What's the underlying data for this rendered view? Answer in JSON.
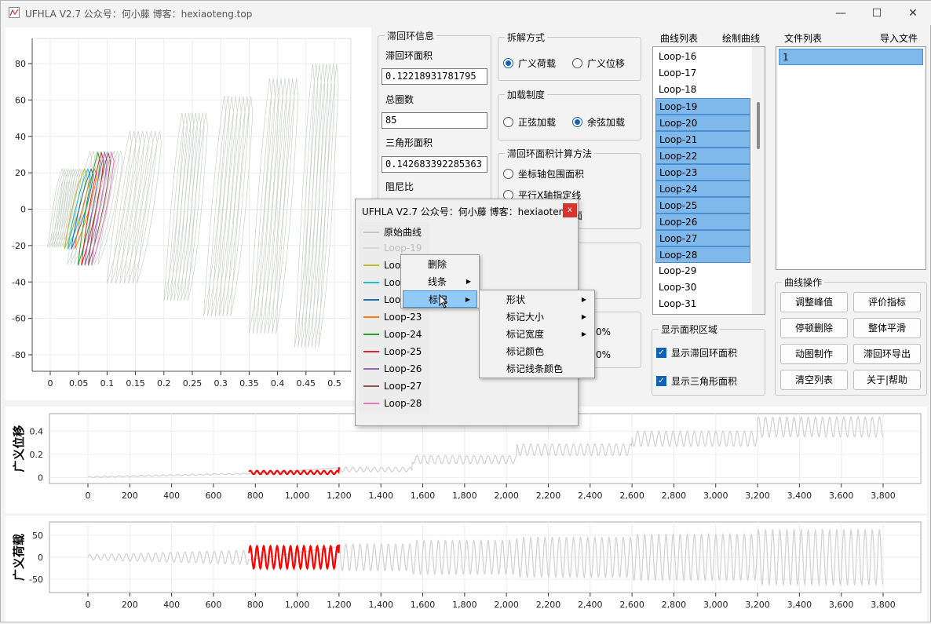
{
  "window": {
    "title": "UFHLA V2.7 公众号：何小藤 博客：hexiaoteng.top",
    "minimize": "—",
    "maximize": "☐",
    "close": "✕"
  },
  "main_plot": {
    "x_ticks": [
      "0",
      "0.05",
      "0.1",
      "0.15",
      "0.2",
      "0.25",
      "0.3",
      "0.35",
      "0.4",
      "0.45",
      "0.5"
    ],
    "y_ticks": [
      "80",
      "60",
      "40",
      "20",
      "0",
      "-20",
      "-40",
      "-60",
      "-80"
    ]
  },
  "hysteresis_info": {
    "title": "滞回环信息",
    "area_label": "滞回环面积",
    "area_value": "0.12218931781795",
    "loops_label": "总圈数",
    "loops_value": "85",
    "triangle_label": "三角形面积",
    "triangle_value": "0.142683392285363",
    "damping_label": "阻尼比"
  },
  "decompose": {
    "title": "拆解方式",
    "opt1": "广义荷载",
    "opt2": "广义位移"
  },
  "loading": {
    "title": "加载制度",
    "opt1": "正弦加载",
    "opt2": "余弦加载"
  },
  "area_method": {
    "title": "滞回环面积计算方法",
    "opt1": "坐标轴包围面积",
    "opt2": "平行X轴指定线",
    "opt3_partial": "面"
  },
  "percent": {
    "v1": "0%",
    "v2": "0%"
  },
  "curve_list": {
    "title": "曲线列表",
    "action": "绘制曲线",
    "items": [
      "Loop-16",
      "Loop-17",
      "Loop-18",
      "Loop-19",
      "Loop-20",
      "Loop-21",
      "Loop-22",
      "Loop-23",
      "Loop-24",
      "Loop-25",
      "Loop-26",
      "Loop-27",
      "Loop-28",
      "Loop-29",
      "Loop-30",
      "Loop-31"
    ]
  },
  "file_list": {
    "title": "文件列表",
    "action": "导入文件",
    "items": [
      "1"
    ]
  },
  "area_display": {
    "title": "显示面积区域",
    "opt1": "显示滞回环面积",
    "opt2": "显示三角形面积"
  },
  "curve_ops": {
    "title": "曲线操作",
    "buttons": [
      "调整峰值",
      "评价指标",
      "停顿删除",
      "整体平滑",
      "动图制作",
      "滞回环导出",
      "清空列表",
      "关于|帮助"
    ]
  },
  "disp_plot": {
    "ylabel": "广义位移",
    "y_ticks": [
      "0.4",
      "0.2",
      "0"
    ],
    "x_ticks": [
      "0",
      "200",
      "400",
      "600",
      "800",
      "1,000",
      "1,200",
      "1,400",
      "1,600",
      "1,800",
      "2,000",
      "2,200",
      "2,400",
      "2,600",
      "2,800",
      "3,000",
      "3,200",
      "3,400",
      "3,600",
      "3,800"
    ]
  },
  "load_plot": {
    "ylabel": "广义荷载",
    "y_ticks": [
      "50",
      "0",
      "-50"
    ],
    "x_ticks": [
      "0",
      "200",
      "400",
      "600",
      "800",
      "1,000",
      "1,200",
      "1,400",
      "1,600",
      "1,800",
      "2,000",
      "2,200",
      "2,400",
      "2,600",
      "2,800",
      "3,000",
      "3,200",
      "3,400",
      "3,600",
      "3,800"
    ]
  },
  "popup": {
    "title": "UFHLA V2.7 公众号：何小藤 博客：hexiaoten...",
    "close": "x",
    "legend": [
      {
        "label": "原始曲线",
        "color": "#c8c8c8"
      },
      {
        "label": "Loop-19",
        "color": "#d8d8d8"
      },
      {
        "label": "Loop",
        "color": "#bcbd22"
      },
      {
        "label": "Loop",
        "color": "#17becf"
      },
      {
        "label": "Loop",
        "color": "#1f6fb4"
      },
      {
        "label": "Loop-23",
        "color": "#ff7f0e"
      },
      {
        "label": "Loop-24",
        "color": "#2ca02c"
      },
      {
        "label": "Loop-25",
        "color": "#d62728"
      },
      {
        "label": "Loop-26",
        "color": "#9467bd"
      },
      {
        "label": "Loop-27",
        "color": "#8c564b"
      },
      {
        "label": "Loop-28",
        "color": "#e377c2"
      }
    ]
  },
  "context_menu": {
    "items": [
      "删除",
      "线条",
      "标记"
    ]
  },
  "submenu": {
    "items": [
      "形状",
      "标记大小",
      "标记宽度",
      "标记颜色",
      "标记线条颜色"
    ]
  },
  "colors": {
    "accent": "#0f62b8",
    "selection": "#7fb8ea",
    "highlight": "#ff0000",
    "raw": "#cfcfcf"
  }
}
